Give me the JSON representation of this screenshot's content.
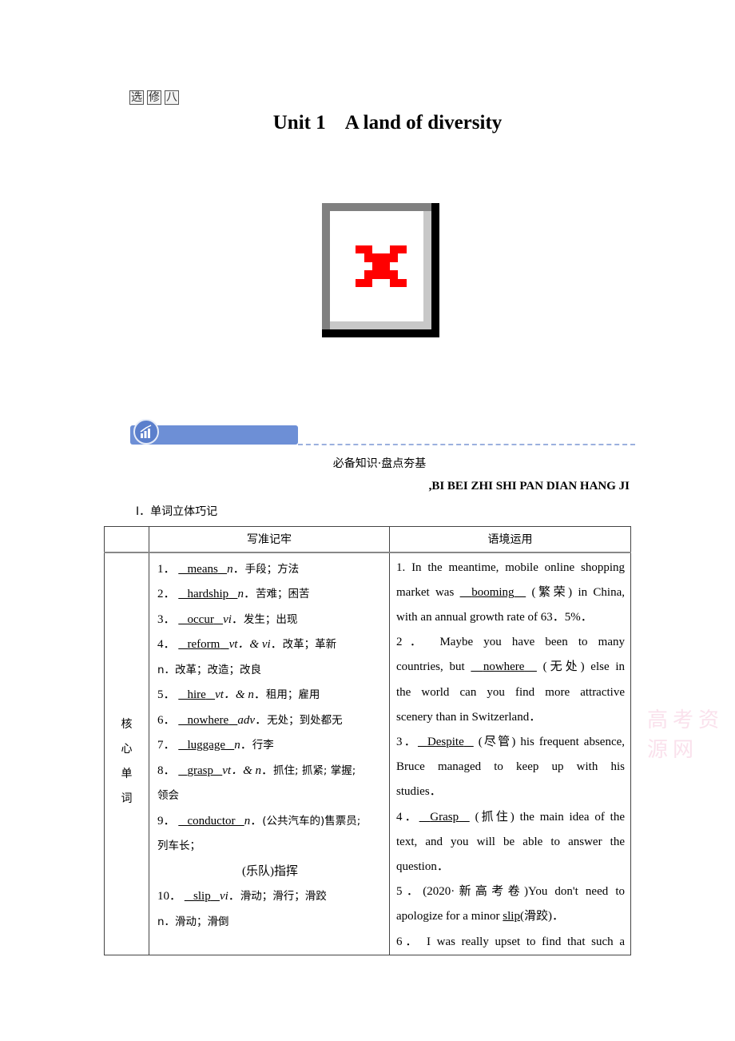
{
  "header": {
    "volume_chars": [
      "选",
      "修",
      "八"
    ],
    "unit_label": "Unit 1",
    "unit_title": "A land of diversity"
  },
  "image_placeholder": {
    "icon": "broken-image-icon"
  },
  "section": {
    "icon": "chart-growth-icon",
    "title_cn": "必备知识·盘点夯基",
    "title_pinyin": ",BI BEI ZHI SHI PAN DIAN HANG JI",
    "subsection_title": "Ⅰ．单词立体巧记"
  },
  "table": {
    "headers": [
      "",
      "写准记牢",
      "语境运用"
    ],
    "category_chars": [
      "核",
      "心",
      "单",
      "词"
    ],
    "vocab": [
      {
        "num": "1．",
        "word": "means",
        "pos": "n",
        "meaning": "手段；方法"
      },
      {
        "num": "2．",
        "word": "hardship",
        "pos": "n",
        "meaning": "苦难；困苦"
      },
      {
        "num": "3．",
        "word": "occur",
        "pos": "vi",
        "meaning": "发生；出现"
      },
      {
        "num": "4．",
        "word": "reform",
        "pos": "vt．& vi",
        "meaning": "改革；革新",
        "extra": "n．改革；改造；改良"
      },
      {
        "num": "5．",
        "word": "hire",
        "pos": "vt．& n",
        "meaning": "租用；雇用"
      },
      {
        "num": "6．",
        "word": "nowhere",
        "pos": "adv",
        "meaning": "无处；到处都无"
      },
      {
        "num": "7．",
        "word": "luggage",
        "pos": "n",
        "meaning": "行李"
      },
      {
        "num": "8．",
        "word": "grasp",
        "pos": "vt．& n",
        "meaning": "抓住; 抓紧; 掌握;",
        "extra": "领会"
      },
      {
        "num": "9．",
        "word": "conductor",
        "pos": "n",
        "meaning": "(公共汽车的)售票员;",
        "extra": "列车长；",
        "extra2": "(乐队)指挥"
      },
      {
        "num": "10．",
        "word": "slip",
        "pos": "vi",
        "meaning": "滑动；滑行；滑跤",
        "extra": "n．滑动；滑倒"
      }
    ],
    "sentences": {
      "s1_l1": "1. In the meantime, mobile online shopping",
      "s1_pre": "market was ",
      "s1_ans": "booming",
      "s1_post": " (繁荣) in China,",
      "s1_l3": "with an annual growth rate of 63．5%．",
      "s2_l1": "2． Maybe you have been to many",
      "s2_pre": "countries, but ",
      "s2_ans": "nowhere",
      "s2_post": " (无处) else in",
      "s2_l3": "the world can you find more attractive",
      "s2_l4": "scenery than in Switzerland．",
      "s3_pre": "3．",
      "s3_ans": "Despite",
      "s3_post": " (尽管) his frequent absence,",
      "s3_l2": "Bruce  managed to keep up with his",
      "s3_l3": "studies．",
      "s4_pre": "4．",
      "s4_ans": "Grasp",
      "s4_post": " (抓住) the main idea of the",
      "s4_l2": "text, and you  will be able to answer the",
      "s4_l3": "question．",
      "s5_l1": "5．(2020·新高考卷)You don't need to",
      "s5_pre": "apologize for a minor ",
      "s5_ans": "slip",
      "s5_post": "(滑跤)．",
      "s6_l1": "6． I was really upset to find that such a"
    }
  },
  "watermark": "高考资源网"
}
